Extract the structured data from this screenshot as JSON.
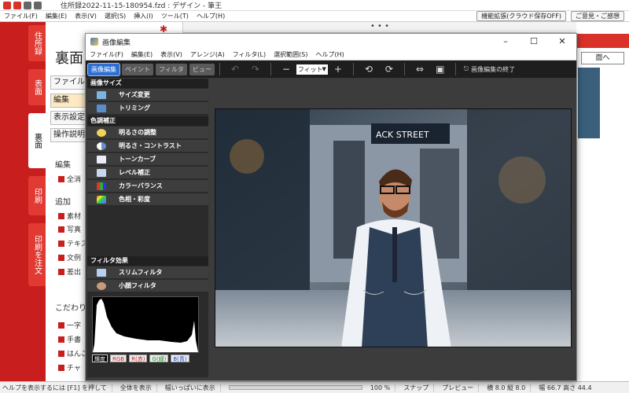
{
  "app": {
    "title": "住所録2022-11-15-180954.fzd : デザイン - 筆王",
    "menu": [
      "ファイル(F)",
      "編集(E)",
      "表示(V)",
      "選択(S)",
      "挿入(I)",
      "ツール(T)",
      "ヘルプ(H)"
    ],
    "cloud_button": "機能拡張(クラウド保存OFF)",
    "feedback_button": "ご意見・ご感想",
    "side_tabs": [
      "住所録",
      "表面",
      "裏面",
      "印刷",
      "印刷を注文"
    ],
    "panel_title": "裏面",
    "panel_buttons": [
      "ファイル",
      "編集",
      "表示設定",
      "操作説明"
    ],
    "panel_sections": {
      "edit_label": "編集",
      "delete_all": "全消",
      "add_label": "追加",
      "add_items": [
        "素材",
        "写真",
        "テキス",
        "文例",
        "差出"
      ],
      "kodawari_label": "こだわり",
      "kodawari_items": [
        "一字",
        "手書",
        "はんこ",
        "チャ"
      ]
    },
    "top_dots": "• • •",
    "right_button": "面へ"
  },
  "statusbar": {
    "help": "ヘルプを表示するには [F1] を押して",
    "show_all": "全体を表示",
    "fit_width": "幅いっぱいに表示",
    "zoom": "100 %",
    "snap": "スナップ",
    "preview": "プレビュー",
    "width": "横 8.0 縦 8.0",
    "size": "幅 66.7 高さ 44.4"
  },
  "dialog": {
    "title": "画像編集",
    "menu": [
      "ファイル(F)",
      "編集(E)",
      "表示(V)",
      "アレンジ(A)",
      "フィルタ(L)",
      "選択範囲(S)",
      "ヘルプ(H)"
    ],
    "mode_tabs": [
      "画像編集",
      "ペイント",
      "フィルタ",
      "ビュー"
    ],
    "zoom_value": "フィット",
    "end_label": "画像編集の終了",
    "sections": {
      "image_size": "画像サイズ",
      "color": "色調補正",
      "filter": "フィルタ効果"
    },
    "tools_size": [
      "サイズ変更",
      "トリミング"
    ],
    "tools_color": [
      "明るさの調整",
      "明るさ・コントラスト",
      "トーンカーブ",
      "レベル補正",
      "カラーバランス",
      "色相・彩度"
    ],
    "tools_filter": [
      "スリムフィルタ",
      "小顔フィルタ"
    ],
    "histogram_tabs": [
      "輝度",
      "RGB",
      "R(赤)",
      "G(緑)",
      "B(青)"
    ],
    "photo_sign": "ACK STREET"
  },
  "colors": {
    "brand_red": "#c81e1e",
    "dialog_bg": "#3b3b3b",
    "active_blue": "#2e6fd1"
  }
}
